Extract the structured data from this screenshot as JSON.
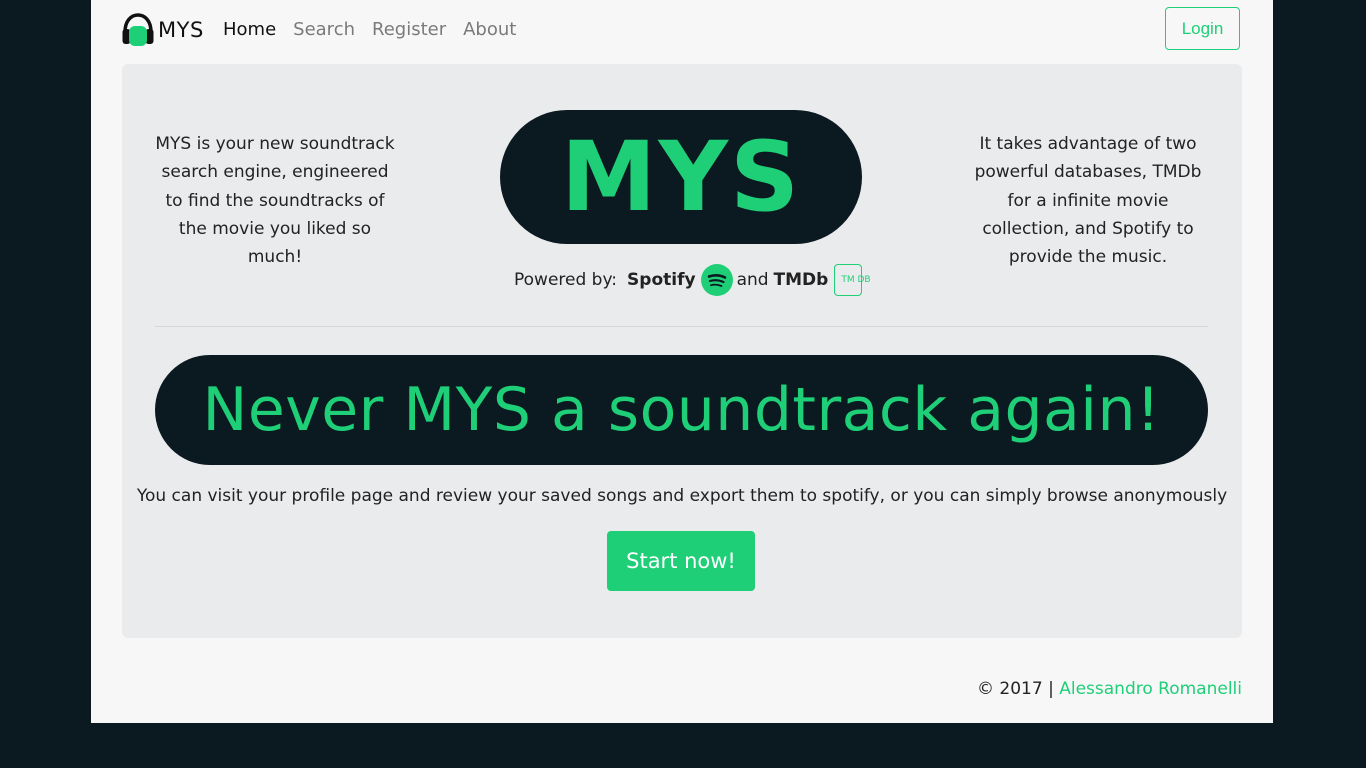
{
  "nav": {
    "brand": "MYS",
    "links": [
      {
        "label": "Home",
        "active": true
      },
      {
        "label": "Search",
        "active": false
      },
      {
        "label": "Register",
        "active": false
      },
      {
        "label": "About",
        "active": false
      }
    ],
    "login_label": "Login"
  },
  "hero": {
    "left_text": "MYS is your new soundtrack search engine, engineered to find the soundtracks of the movie you liked so much!",
    "title": "MYS",
    "right_text": "It takes advantage of two powerful databases, TMDb for a infinite movie collection, and Spotify to provide the music.",
    "powered_label": "Powered by:",
    "spotify_label": "Spotify",
    "and_label": "and",
    "tmdb_label": "TMDb",
    "tmdb_icon_text": "TM DB"
  },
  "slogan": "Never MYS a soundtrack again!",
  "description": "You can visit your profile page and review your saved songs and export them to spotify, or you can simply browse anonymously",
  "start_button": "Start now!",
  "footer": {
    "copyright": "© 2017 |",
    "author": "Alessandro Romanelli"
  },
  "colors": {
    "accent": "#1fcf78",
    "dark": "#0b1a20",
    "panel": "#eaebed"
  },
  "icons": {
    "brand": "headphones-icon",
    "spotify": "spotify-icon",
    "tmdb": "tmdb-icon"
  }
}
